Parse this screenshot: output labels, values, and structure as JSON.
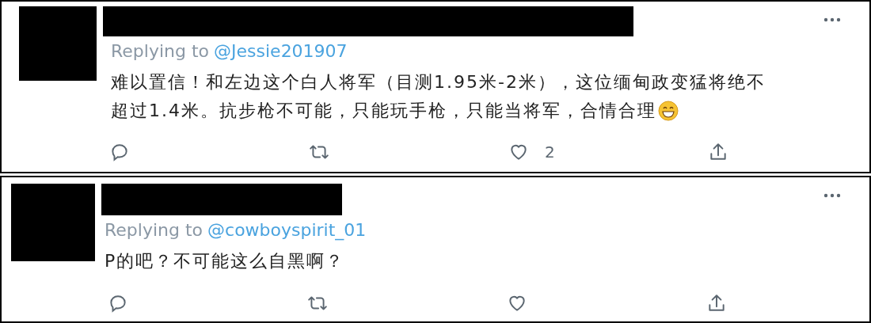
{
  "tweets": [
    {
      "replying_label": "Replying to",
      "reply_to": "@Jessie201907",
      "text_lines": [
        "难以置信！和左边这个白人将军（目测1.95米-2米），这位缅甸政变猛将绝不",
        "超过1.4米。抗步枪不可能，只能玩手枪，只能当将军，合情合理"
      ],
      "ends_with_emoji": true,
      "like_count": "2"
    },
    {
      "replying_label": "Replying to",
      "reply_to": "@cowboyspirit_01",
      "text_lines": [
        "P的吧？不可能这么自黑啊？"
      ]
    }
  ]
}
